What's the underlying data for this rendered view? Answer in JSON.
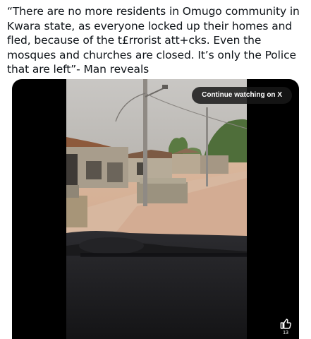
{
  "post": {
    "text": "“There are no more residents in Omugo community in Kwara state, as everyone locked up their homes and fled, because of the t£rrorist att+cks. Even the mosques and churches are closed. It’s only the Police that are left”- Man reveals"
  },
  "video": {
    "continue_label": "Continue watching on X",
    "like_icon": "thumbs-up-icon",
    "like_count": "13"
  }
}
